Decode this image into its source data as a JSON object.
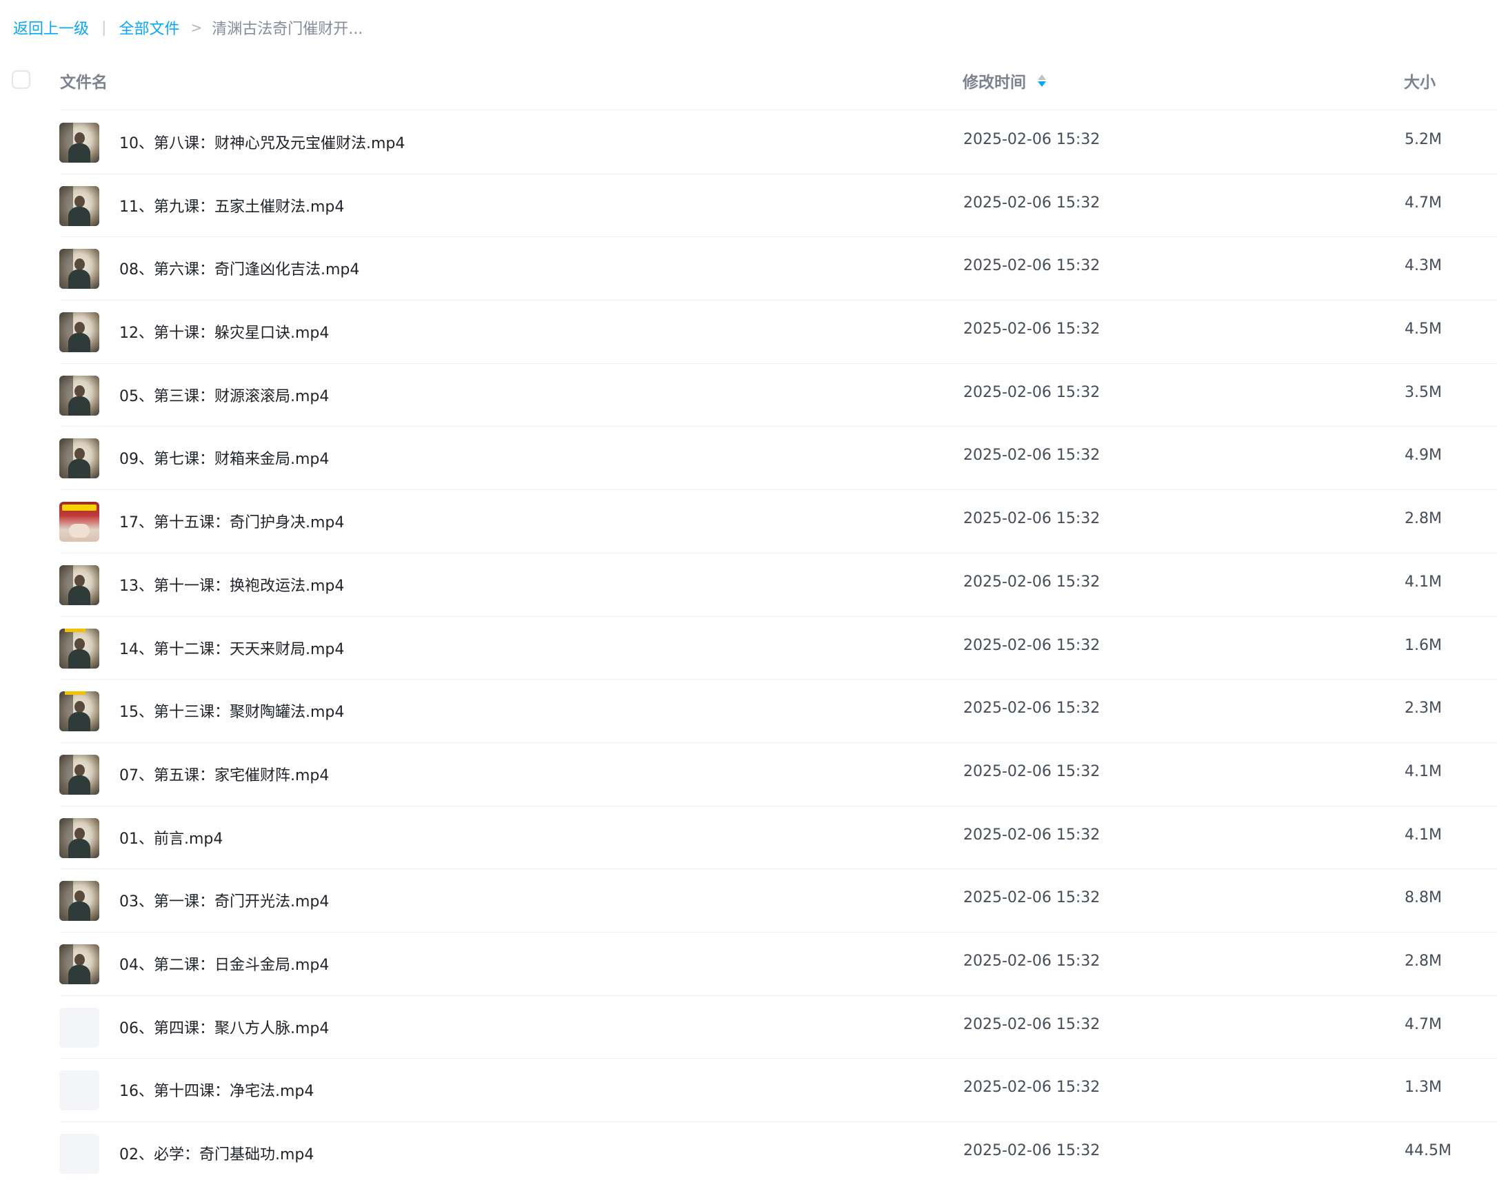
{
  "breadcrumb": {
    "back_label": "返回上一级",
    "separator": "|",
    "root_label": "全部文件",
    "arrow": ">",
    "current_label": "清渊古法奇门催财开..."
  },
  "table": {
    "columns": {
      "name": "文件名",
      "modified": "修改时间",
      "size": "大小"
    },
    "sort": {
      "column": "modified",
      "direction": "descending"
    },
    "accent_color": "#06a7ff",
    "rows": [
      {
        "name": "10、第八课：财神心咒及元宝催财法.mp4",
        "modified": "2025-02-06 15:32",
        "size": "5.2M",
        "thumbnail": "video-thumbnail"
      },
      {
        "name": "11、第九课：五家土催财法.mp4",
        "modified": "2025-02-06 15:32",
        "size": "4.7M",
        "thumbnail": "video-thumbnail"
      },
      {
        "name": "08、第六课：奇门逢凶化吉法.mp4",
        "modified": "2025-02-06 15:32",
        "size": "4.3M",
        "thumbnail": "video-thumbnail"
      },
      {
        "name": "12、第十课：躲灾星口诀.mp4",
        "modified": "2025-02-06 15:32",
        "size": "4.5M",
        "thumbnail": "video-thumbnail"
      },
      {
        "name": "05、第三课：财源滚滚局.mp4",
        "modified": "2025-02-06 15:32",
        "size": "3.5M",
        "thumbnail": "video-thumbnail"
      },
      {
        "name": "09、第七课：财箱来金局.mp4",
        "modified": "2025-02-06 15:32",
        "size": "4.9M",
        "thumbnail": "video-thumbnail"
      },
      {
        "name": "17、第十五课：奇门护身决.mp4",
        "modified": "2025-02-06 15:32",
        "size": "2.8M",
        "thumbnail": "video-thumbnail-ad"
      },
      {
        "name": "13、第十一课：换袍改运法.mp4",
        "modified": "2025-02-06 15:32",
        "size": "4.1M",
        "thumbnail": "video-thumbnail"
      },
      {
        "name": "14、第十二课：天天来财局.mp4",
        "modified": "2025-02-06 15:32",
        "size": "1.6M",
        "thumbnail": "video-thumbnail-yellow"
      },
      {
        "name": "15、第十三课：聚财陶罐法.mp4",
        "modified": "2025-02-06 15:32",
        "size": "2.3M",
        "thumbnail": "video-thumbnail-yellow"
      },
      {
        "name": "07、第五课：家宅催财阵.mp4",
        "modified": "2025-02-06 15:32",
        "size": "4.1M",
        "thumbnail": "video-thumbnail"
      },
      {
        "name": "01、前言.mp4",
        "modified": "2025-02-06 15:32",
        "size": "4.1M",
        "thumbnail": "video-thumbnail"
      },
      {
        "name": "03、第一课：奇门开光法.mp4",
        "modified": "2025-02-06 15:32",
        "size": "8.8M",
        "thumbnail": "video-thumbnail"
      },
      {
        "name": "04、第二课：日金斗金局.mp4",
        "modified": "2025-02-06 15:32",
        "size": "2.8M",
        "thumbnail": "video-thumbnail"
      },
      {
        "name": "06、第四课：聚八方人脉.mp4",
        "modified": "2025-02-06 15:32",
        "size": "4.7M",
        "thumbnail": "placeholder"
      },
      {
        "name": "16、第十四课：净宅法.mp4",
        "modified": "2025-02-06 15:32",
        "size": "1.3M",
        "thumbnail": "placeholder"
      },
      {
        "name": "02、必学：奇门基础功.mp4",
        "modified": "2025-02-06 15:32",
        "size": "44.5M",
        "thumbnail": "placeholder"
      }
    ]
  }
}
